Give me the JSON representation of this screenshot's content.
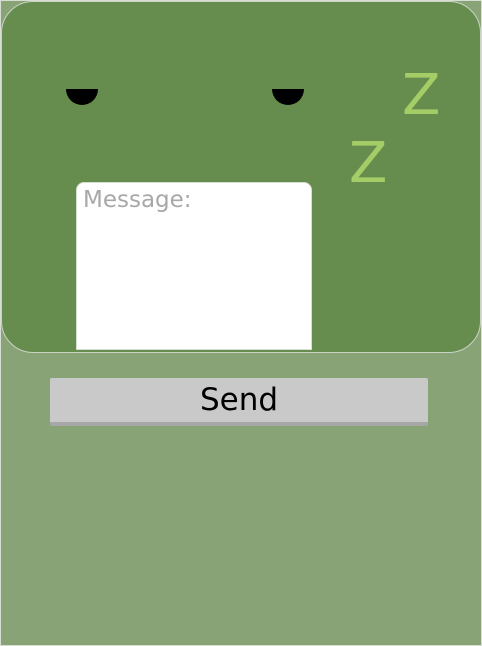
{
  "face": {
    "sleep_letters": [
      "Z",
      "Z"
    ],
    "colors": {
      "background": "#88a476",
      "panel": "#668d4e",
      "zzz": "#a4cc67",
      "eye": "#000000"
    }
  },
  "message": {
    "placeholder": "Message:",
    "value": ""
  },
  "actions": {
    "send_label": "Send"
  }
}
